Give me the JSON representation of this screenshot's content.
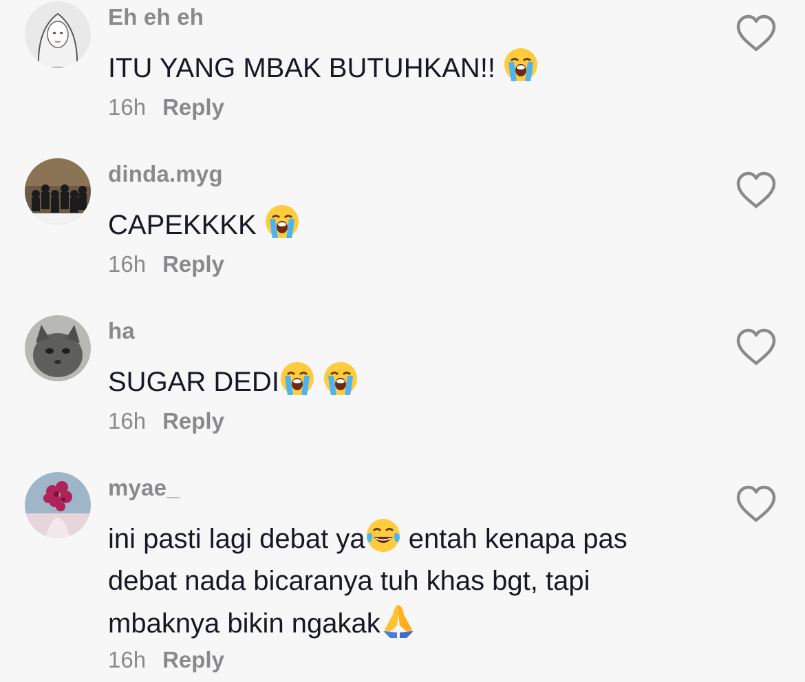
{
  "comments": [
    {
      "username": "Eh eh eh",
      "text_parts": [
        "ITU YANG MBAK BUTUHKAN!! "
      ],
      "emojis": [
        "loudly-crying-face"
      ],
      "time": "16h",
      "reply": "Reply"
    },
    {
      "username": "dinda.myg",
      "text_parts": [
        "CAPEKKKK "
      ],
      "emojis": [
        "loudly-crying-face"
      ],
      "time": "16h",
      "reply": "Reply"
    },
    {
      "username": "ha",
      "text_parts": [
        "SUGAR DEDI"
      ],
      "emojis": [
        "loudly-crying-face",
        "loudly-crying-face"
      ],
      "time": "16h",
      "reply": "Reply"
    },
    {
      "username": "myae_",
      "text_lines": [
        "ini pasti lagi debat ya",
        " entah kenapa pas",
        "debat nada bicaranya tuh khas bgt, tapi",
        "mbaknya bikin ngakak"
      ],
      "emojis": [
        "face-with-tears-of-joy",
        "folded-hands"
      ],
      "time": "16h",
      "reply": "Reply"
    }
  ],
  "icons": {
    "like": "heart-outline-icon"
  },
  "colors": {
    "background": "#f7f7f7",
    "text": "#161823",
    "muted": "#8a8a8d"
  }
}
